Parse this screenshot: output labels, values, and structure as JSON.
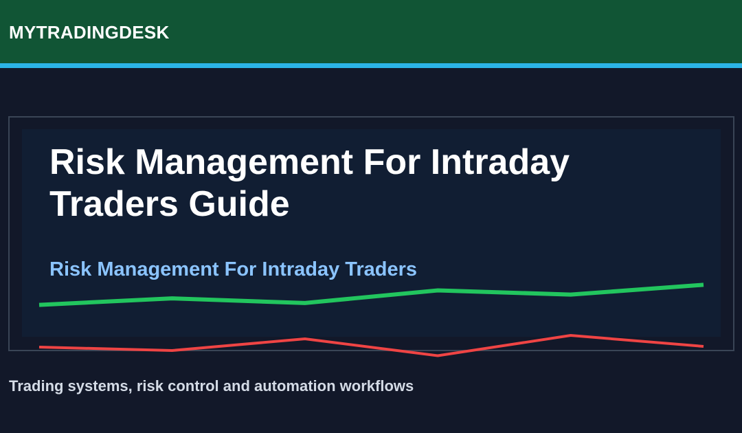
{
  "header": {
    "brand": "MYTRADINGDESK",
    "bar_color": "#115535",
    "accent_color": "#2cb4e6"
  },
  "hero": {
    "title": "Risk Management For Intraday Traders Guide",
    "subtitle": "Risk Management For Intraday Traders"
  },
  "footer": {
    "tagline": "Trading systems, risk control and automation workflows"
  },
  "decor_lines": [
    {
      "name": "green-line",
      "color": "#22c55e",
      "values": [
        0.3,
        0.44,
        0.34,
        0.61,
        0.52,
        0.73
      ]
    },
    {
      "name": "red-line",
      "color": "#ef4444",
      "values": [
        0.5,
        0.4,
        0.74,
        0.25,
        0.84,
        0.52
      ]
    }
  ]
}
